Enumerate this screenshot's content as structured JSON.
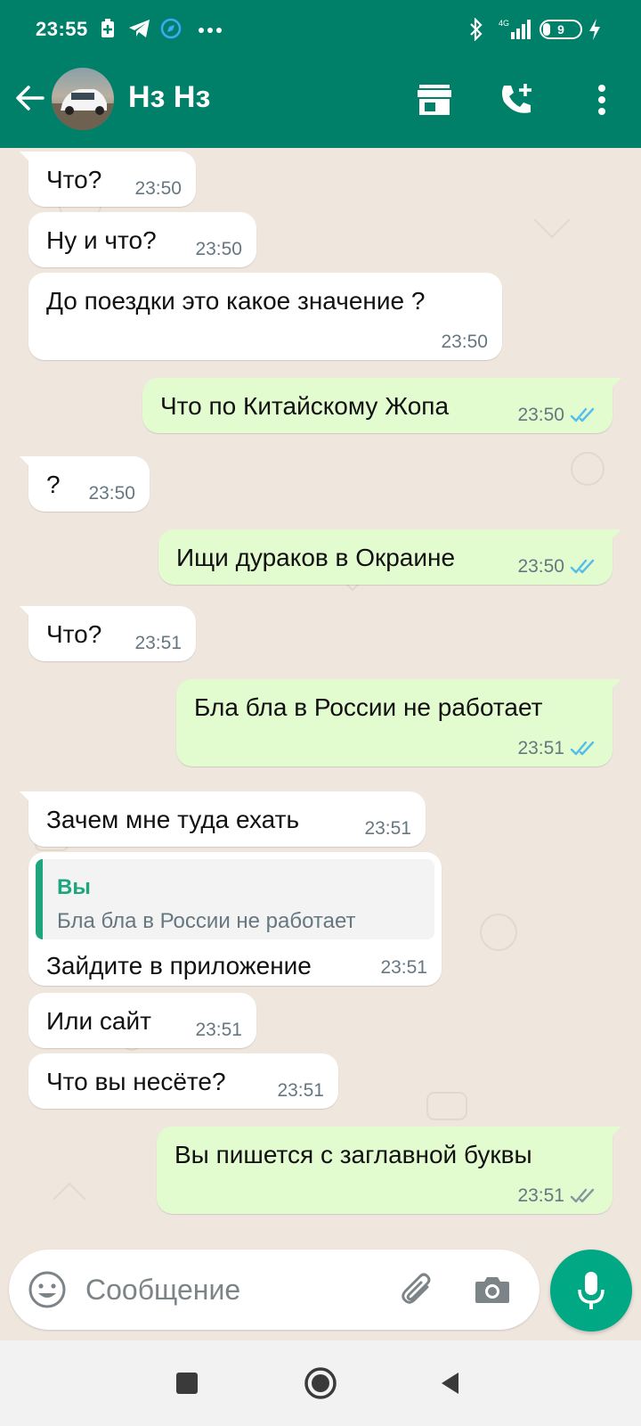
{
  "status_bar": {
    "time": "23:55",
    "network": "4G",
    "battery_level": "9"
  },
  "header": {
    "contact_name": "Нз Нз"
  },
  "messages": [
    {
      "dir": "in",
      "text": "Что?",
      "time": "23:50"
    },
    {
      "dir": "in",
      "text": "Ну и что?",
      "time": "23:50"
    },
    {
      "dir": "in",
      "text": "До поездки это какое значение ?",
      "time": "23:50"
    },
    {
      "dir": "out",
      "text": "Что по Китайскому Жопа",
      "time": "23:50",
      "status": "read"
    },
    {
      "dir": "in",
      "text": "?",
      "time": "23:50"
    },
    {
      "dir": "out",
      "text": "Ищи дураков в Окраине",
      "time": "23:50",
      "status": "read"
    },
    {
      "dir": "in",
      "text": "Что?",
      "time": "23:51"
    },
    {
      "dir": "out",
      "text": "Бла бла в России не работает",
      "time": "23:51",
      "status": "read"
    },
    {
      "dir": "in",
      "text": "Зачем мне туда ехать",
      "time": "23:51"
    },
    {
      "dir": "in",
      "text": "Зайдите в приложение",
      "time": "23:51",
      "quote": {
        "author": "Вы",
        "text": "Бла бла в России не работает"
      }
    },
    {
      "dir": "in",
      "text": "Или сайт",
      "time": "23:51"
    },
    {
      "dir": "in",
      "text": "Что вы несёте?",
      "time": "23:51"
    },
    {
      "dir": "out",
      "text": "Вы пишется с заглавной буквы",
      "time": "23:51",
      "status": "delivered"
    }
  ],
  "composer": {
    "placeholder": "Сообщение"
  },
  "colors": {
    "header": "#008069",
    "outgoing_bubble": "#e2fcd0",
    "incoming_bubble": "#ffffff",
    "accent": "#00a884",
    "read_ticks": "#53bdeb",
    "delivered_ticks": "#8696a0"
  },
  "icons": [
    "back-arrow-icon",
    "store-icon",
    "add-call-icon",
    "more-vert-icon",
    "emoji-icon",
    "attach-icon",
    "camera-icon",
    "mic-icon",
    "bluetooth-icon",
    "signal-icon",
    "battery-icon"
  ]
}
